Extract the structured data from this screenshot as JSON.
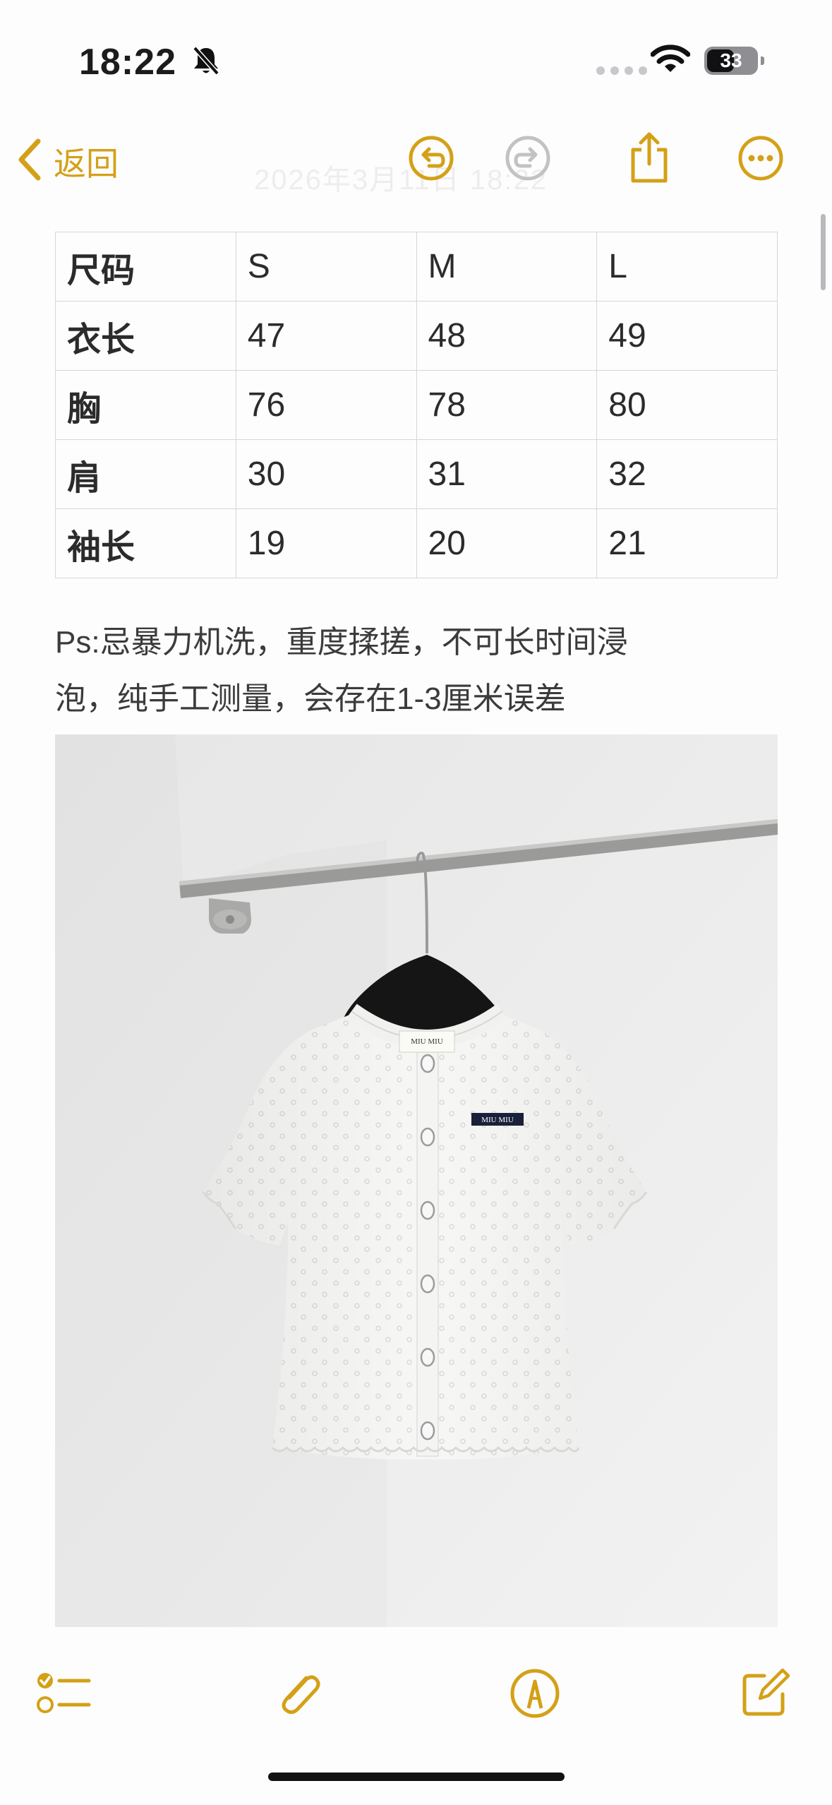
{
  "status_bar": {
    "time": "18:22",
    "battery_level": "33"
  },
  "nav": {
    "back_label": "返回",
    "faded_title": "2026年3月11日 18:22"
  },
  "size_table": {
    "rows": [
      [
        "尺码",
        "S",
        "M",
        "L"
      ],
      [
        "衣长",
        "47",
        "48",
        "49"
      ],
      [
        "胸",
        "76",
        "78",
        "80"
      ],
      [
        "肩",
        "30",
        "31",
        "32"
      ],
      [
        "袖长",
        "19",
        "20",
        "21"
      ]
    ]
  },
  "note": {
    "line1": "Ps:忌暴力机洗，重度揉搓，不可长时间浸",
    "line2": "泡，纯手工测量，会存在1-3厘米误差"
  },
  "photo": {
    "neck_label": "MIU MIU",
    "chest_label": "MIU MIU"
  },
  "colors": {
    "accent": "#d4a017",
    "disabled": "#c2c2c2"
  },
  "icons": [
    "chevron-left-icon",
    "undo-icon",
    "redo-icon",
    "share-icon",
    "more-icon",
    "checklist-icon",
    "attachment-icon",
    "markup-icon",
    "compose-icon"
  ]
}
